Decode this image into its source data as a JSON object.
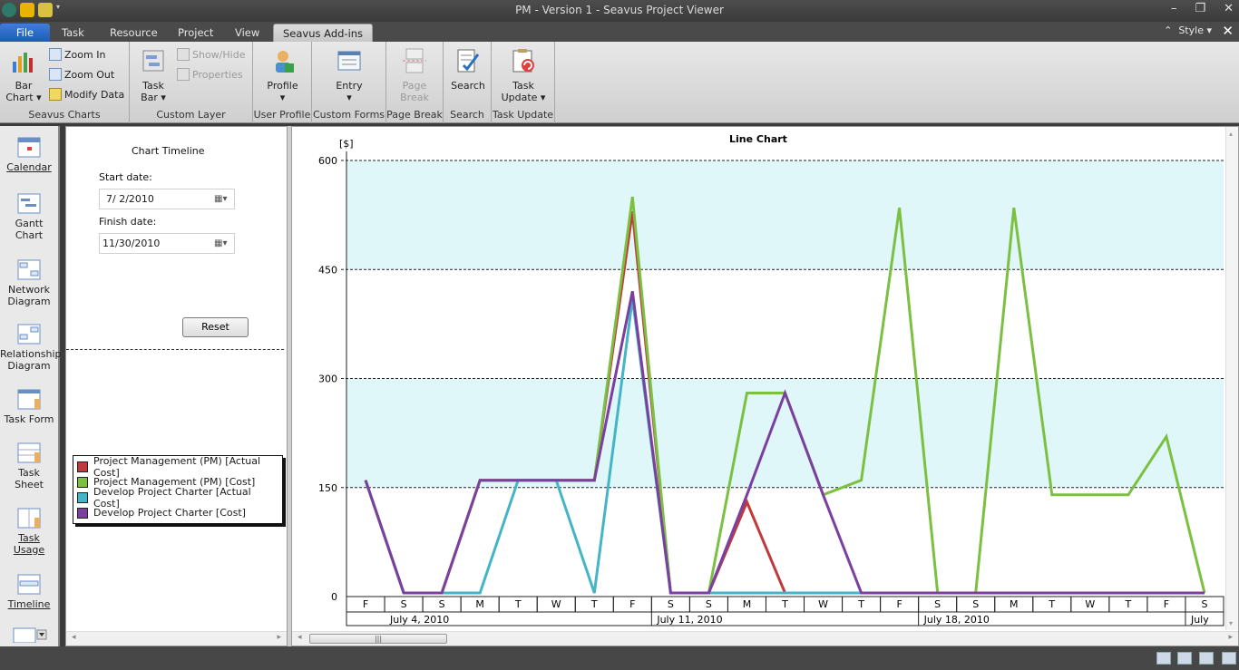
{
  "window": {
    "title": "PM - Version 1 - Seavus Project Viewer",
    "style_label": "Style"
  },
  "tabs": [
    "File",
    "Task",
    "Resource",
    "Project",
    "View",
    "Seavus Add-ins"
  ],
  "ribbon": {
    "bar_chart": "Bar\nChart",
    "zoom_in": "Zoom In",
    "zoom_out": "Zoom Out",
    "modify_data": "Modify Data",
    "seavus_charts": "Seavus Charts",
    "task_bar": "Task\nBar",
    "show_hide": "Show/Hide",
    "properties": "Properties",
    "custom_layer": "Custom Layer",
    "profile": "Profile",
    "user_profile": "User Profile",
    "entry": "Entry",
    "custom_forms": "Custom Forms",
    "page_break_btn": "Page\nBreak",
    "page_break": "Page Break",
    "search_btn": "Search",
    "search": "Search",
    "task_update_btn": "Task\nUpdate",
    "task_update": "Task Update"
  },
  "nav": [
    "Calendar",
    "Gantt\nChart",
    "Network\nDiagram",
    "Relationship\nDiagram",
    "Task Form",
    "Task\nSheet",
    "Task\nUsage",
    "Timeline"
  ],
  "timeline": {
    "header": "Chart Timeline",
    "start_label": "Start date:",
    "start_value": "7/  2/2010",
    "finish_label": "Finish date:",
    "finish_value": "11/30/2010",
    "reset": "Reset"
  },
  "chart_data": {
    "type": "line",
    "title": "Line Chart",
    "ylabel": "[$]",
    "ylim": [
      0,
      600
    ],
    "yticks": [
      0,
      150,
      300,
      450,
      600
    ],
    "day_labels": [
      "F",
      "S",
      "S",
      "M",
      "T",
      "W",
      "T",
      "F",
      "S",
      "S",
      "M",
      "T",
      "W",
      "T",
      "F",
      "S",
      "S",
      "M",
      "T",
      "W",
      "T",
      "F",
      "S"
    ],
    "week_labels": [
      "July 4, 2010",
      "July 11, 2010",
      "July 18, 2010",
      "July"
    ],
    "bands": [
      [
        150,
        300
      ],
      [
        450,
        600
      ]
    ],
    "series": [
      {
        "name": "Project Management (PM) [Actual Cost]",
        "color": "#c0393b",
        "values": [
          160,
          5,
          5,
          160,
          160,
          160,
          160,
          530,
          5,
          5,
          130,
          5,
          5,
          5,
          null,
          null,
          null,
          null,
          null,
          null,
          null,
          null,
          null
        ]
      },
      {
        "name": "Project Management (PM) [Cost]",
        "color": "#7cc042",
        "values": [
          160,
          5,
          5,
          160,
          160,
          160,
          160,
          550,
          5,
          5,
          280,
          280,
          140,
          160,
          535,
          5,
          5,
          535,
          140,
          140,
          140,
          220,
          5
        ]
      },
      {
        "name": "Develop Project Charter [Actual Cost]",
        "color": "#43b5c6",
        "values": [
          160,
          5,
          5,
          5,
          160,
          160,
          5,
          410,
          5,
          5,
          5,
          5,
          5,
          5,
          null,
          null,
          null,
          null,
          null,
          null,
          null,
          null,
          null
        ]
      },
      {
        "name": "Develop Project Charter [Cost]",
        "color": "#7b3fa0",
        "values": [
          160,
          5,
          5,
          160,
          160,
          160,
          160,
          420,
          5,
          5,
          140,
          280,
          140,
          5,
          5,
          5,
          5,
          5,
          5,
          5,
          5,
          5,
          5
        ]
      }
    ]
  }
}
